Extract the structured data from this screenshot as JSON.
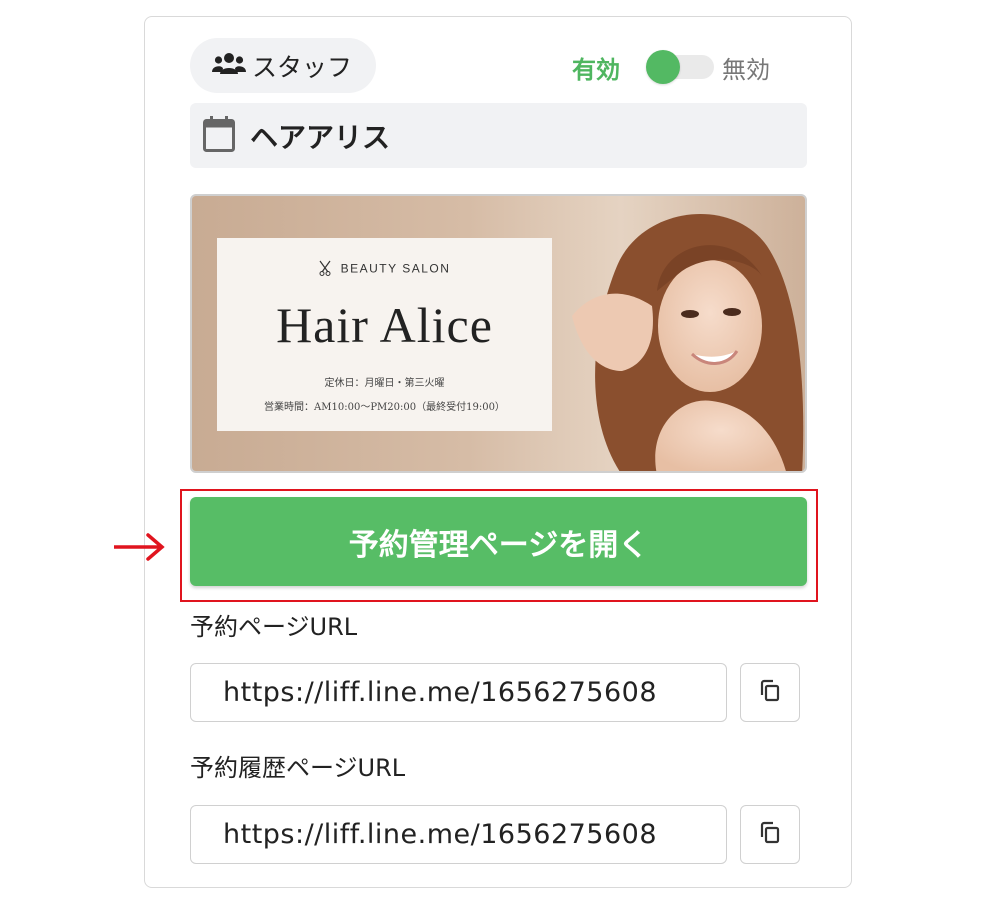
{
  "staff_chip": {
    "label": "スタッフ",
    "icon": "users-icon"
  },
  "status_toggle": {
    "on_label": "有効",
    "off_label": "無効",
    "state": "on",
    "accent": "#53b963"
  },
  "salon": {
    "name": "ヘアアリス",
    "icon": "calendar-icon"
  },
  "banner": {
    "eyebrow": "BEAUTY SALON",
    "brand": "Hair Alice",
    "closed_days": "定休日：月曜日・第三火曜",
    "hours": "営業時間：AM10:00～PM20:00（最終受付19:00）"
  },
  "cta": {
    "label": "予約管理ページを開く",
    "color": "#57bd66"
  },
  "booking_url": {
    "label": "予約ページURL",
    "value": "https://liff.line.me/1656275608"
  },
  "history_url": {
    "label": "予約履歴ページURL",
    "value": "https://liff.line.me/1656275608"
  },
  "annotation": {
    "highlight_color": "#e0141e"
  }
}
